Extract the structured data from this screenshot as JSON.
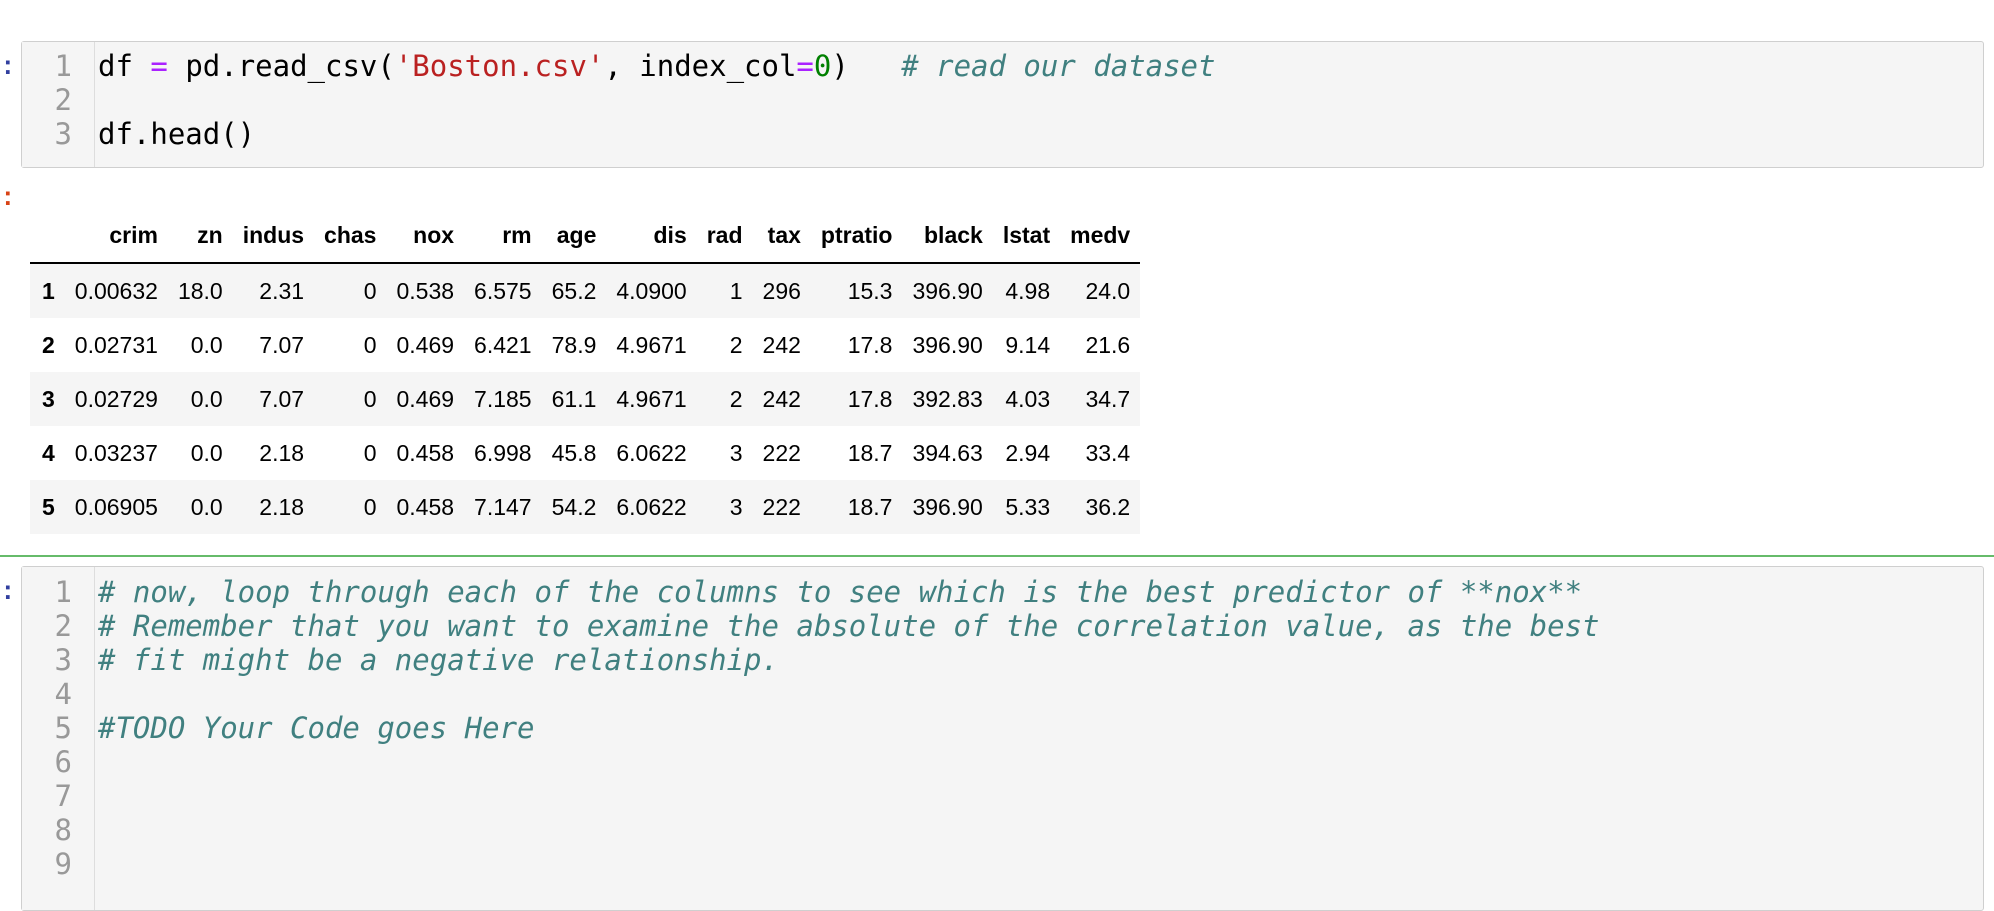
{
  "cell1": {
    "lines": [
      {
        "n": "1",
        "tokens": [
          {
            "t": "df ",
            "c": "plain"
          },
          {
            "t": "=",
            "c": "op"
          },
          {
            "t": " pd.read_csv(",
            "c": "plain"
          },
          {
            "t": "'Boston.csv'",
            "c": "str"
          },
          {
            "t": ", index_col",
            "c": "plain"
          },
          {
            "t": "=",
            "c": "op"
          },
          {
            "t": "0",
            "c": "num"
          },
          {
            "t": ")   ",
            "c": "plain"
          },
          {
            "t": "# read our dataset",
            "c": "cmt"
          }
        ]
      },
      {
        "n": "2",
        "tokens": []
      },
      {
        "n": "3",
        "tokens": [
          {
            "t": "df.head()",
            "c": "plain"
          }
        ]
      }
    ]
  },
  "output": {
    "columns": [
      "",
      "crim",
      "zn",
      "indus",
      "chas",
      "nox",
      "rm",
      "age",
      "dis",
      "rad",
      "tax",
      "ptratio",
      "black",
      "lstat",
      "medv"
    ],
    "rows": [
      [
        "1",
        "0.00632",
        "18.0",
        "2.31",
        "0",
        "0.538",
        "6.575",
        "65.2",
        "4.0900",
        "1",
        "296",
        "15.3",
        "396.90",
        "4.98",
        "24.0"
      ],
      [
        "2",
        "0.02731",
        "0.0",
        "7.07",
        "0",
        "0.469",
        "6.421",
        "78.9",
        "4.9671",
        "2",
        "242",
        "17.8",
        "396.90",
        "9.14",
        "21.6"
      ],
      [
        "3",
        "0.02729",
        "0.0",
        "7.07",
        "0",
        "0.469",
        "7.185",
        "61.1",
        "4.9671",
        "2",
        "242",
        "17.8",
        "392.83",
        "4.03",
        "34.7"
      ],
      [
        "4",
        "0.03237",
        "0.0",
        "2.18",
        "0",
        "0.458",
        "6.998",
        "45.8",
        "6.0622",
        "3",
        "222",
        "18.7",
        "394.63",
        "2.94",
        "33.4"
      ],
      [
        "5",
        "0.06905",
        "0.0",
        "2.18",
        "0",
        "0.458",
        "7.147",
        "54.2",
        "6.0622",
        "3",
        "222",
        "18.7",
        "396.90",
        "5.33",
        "36.2"
      ]
    ]
  },
  "cell2": {
    "lines": [
      {
        "n": "1",
        "tokens": [
          {
            "t": "# now, loop through each of the columns to see which is the best predictor of **nox**",
            "c": "cmt"
          }
        ]
      },
      {
        "n": "2",
        "tokens": [
          {
            "t": "# Remember that you want to examine the absolute of the correlation value, as the best",
            "c": "cmt"
          }
        ]
      },
      {
        "n": "3",
        "tokens": [
          {
            "t": "# fit might be a negative relationship.",
            "c": "cmt"
          }
        ]
      },
      {
        "n": "4",
        "tokens": []
      },
      {
        "n": "5",
        "tokens": [
          {
            "t": "#TODO Your Code goes Here",
            "c": "cmt"
          }
        ]
      },
      {
        "n": "6",
        "tokens": []
      },
      {
        "n": "7",
        "tokens": []
      },
      {
        "n": "8",
        "tokens": []
      },
      {
        "n": "9",
        "tokens": []
      }
    ]
  }
}
